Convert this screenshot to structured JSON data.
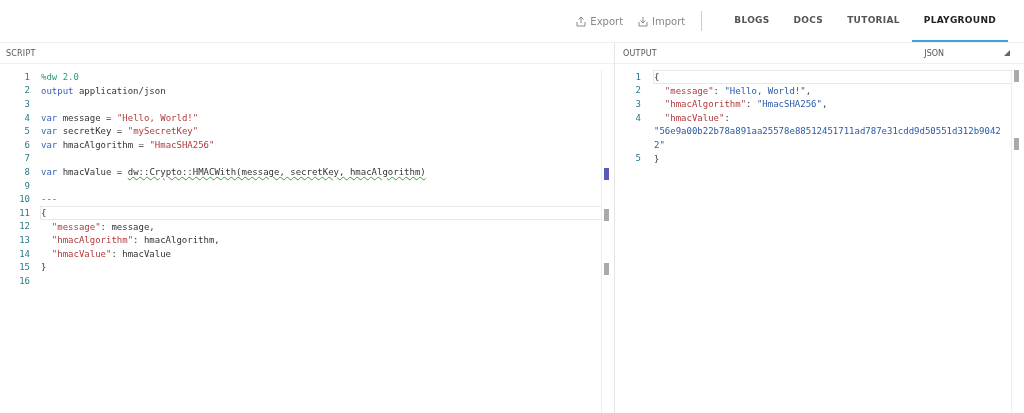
{
  "toolbar": {
    "actions": [
      {
        "label": "Export",
        "kind": "export"
      },
      {
        "label": "Import",
        "kind": "import"
      }
    ],
    "tabs": [
      {
        "label": "BLOGS",
        "selected": false
      },
      {
        "label": "DOCS",
        "selected": false
      },
      {
        "label": "TUTORIAL",
        "selected": false
      },
      {
        "label": "PLAYGROUND",
        "selected": true
      }
    ]
  },
  "script": {
    "title": "SCRIPT",
    "lines": [
      {
        "number": "1",
        "current": false,
        "tokens": [
          {
            "text": "%dw 2.0",
            "kind": "directive"
          }
        ]
      },
      {
        "number": "2",
        "current": false,
        "tokens": [
          {
            "text": "output",
            "kind": "keyword"
          },
          {
            "text": " application/json",
            "kind": "plain"
          }
        ]
      },
      {
        "number": "3",
        "current": false
      },
      {
        "number": "4",
        "current": false,
        "tokens": [
          {
            "text": "var",
            "kind": "keyword"
          },
          {
            "text": " message = ",
            "kind": "plain"
          },
          {
            "text": "\"Hello, World!\"",
            "kind": "string"
          }
        ]
      },
      {
        "number": "5",
        "current": false,
        "tokens": [
          {
            "text": "var",
            "kind": "keyword"
          },
          {
            "text": " secretKey = ",
            "kind": "plain"
          },
          {
            "text": "\"mySecretKey\"",
            "kind": "string"
          }
        ]
      },
      {
        "number": "6",
        "current": false,
        "tokens": [
          {
            "text": "var",
            "kind": "keyword"
          },
          {
            "text": " hmacAlgorithm = ",
            "kind": "plain"
          },
          {
            "text": "\"HmacSHA256\"",
            "kind": "string"
          }
        ]
      },
      {
        "number": "7",
        "current": false
      },
      {
        "number": "8",
        "current": false,
        "tokens": [
          {
            "text": "var",
            "kind": "keyword"
          },
          {
            "text": " hmacValue = ",
            "kind": "plain"
          },
          {
            "text": "dw::Crypto::HMACWith(message, secretKey, hmacAlgorithm)",
            "kind": "warning"
          }
        ]
      },
      {
        "number": "9",
        "current": false
      },
      {
        "number": "10",
        "current": false,
        "tokens": [
          {
            "text": "---",
            "kind": "keyword"
          }
        ]
      },
      {
        "number": "11",
        "current": true,
        "tokens": [
          {
            "text": "{",
            "kind": "plain"
          }
        ]
      },
      {
        "number": "12",
        "current": false,
        "indent": true,
        "tokens": [
          {
            "text": "\"message\"",
            "kind": "string"
          },
          {
            "text": ": message,",
            "kind": "plain"
          }
        ]
      },
      {
        "number": "13",
        "current": false,
        "indent": true,
        "tokens": [
          {
            "text": "\"hmacAlgorithm\"",
            "kind": "string"
          },
          {
            "text": ": hmacAlgorithm,",
            "kind": "plain"
          }
        ]
      },
      {
        "number": "14",
        "current": false,
        "indent": true,
        "tokens": [
          {
            "text": "\"hmacValue\"",
            "kind": "string"
          },
          {
            "text": ": hmacValue",
            "kind": "plain"
          }
        ]
      },
      {
        "number": "15",
        "current": false,
        "tokens": [
          {
            "text": "}",
            "kind": "plain"
          }
        ]
      },
      {
        "number": "16",
        "current": false
      }
    ]
  },
  "output": {
    "title": "OUTPUT",
    "format": "JSON",
    "lines": [
      {
        "number": "1",
        "current": true,
        "tokens": [
          {
            "text": "{",
            "kind": "plain"
          }
        ]
      },
      {
        "number": "2",
        "current": false,
        "indent": true,
        "tokens": [
          {
            "text": "\"message\"",
            "kind": "string"
          },
          {
            "text": ": ",
            "kind": "plain"
          },
          {
            "text": "\"Hello, World!\"",
            "kind": "value"
          },
          {
            "text": ",",
            "kind": "plain"
          }
        ]
      },
      {
        "number": "3",
        "current": false,
        "indent": true,
        "tokens": [
          {
            "text": "\"hmacAlgorithm\"",
            "kind": "string"
          },
          {
            "text": ": ",
            "kind": "plain"
          },
          {
            "text": "\"HmacSHA256\"",
            "kind": "value"
          },
          {
            "text": ",",
            "kind": "plain"
          }
        ]
      },
      {
        "number": "4",
        "current": false,
        "indent": true,
        "tokens": [
          {
            "text": "\"hmacValue\"",
            "kind": "string"
          },
          {
            "text": ":",
            "kind": "plain"
          }
        ]
      },
      {
        "current": false,
        "tokens": [
          {
            "text": "\"56e9a00b22b78a891aa25578e88512451711ad787e31cdd9d50551d312b9042",
            "kind": "value"
          }
        ]
      },
      {
        "current": false,
        "tokens": [
          {
            "text": "2\"",
            "kind": "value"
          }
        ]
      },
      {
        "number": "5",
        "current": false,
        "tokens": [
          {
            "text": "}",
            "kind": "plain"
          }
        ]
      }
    ]
  }
}
